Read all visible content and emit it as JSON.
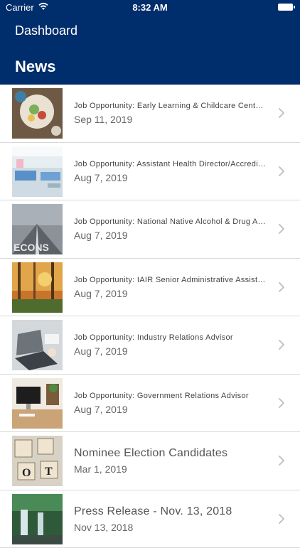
{
  "status_bar": {
    "carrier": "Carrier",
    "time": "8:32 AM"
  },
  "nav": {
    "back_label": "Dashboard",
    "title": "News"
  },
  "news": [
    {
      "title": "Job Opportunity: Early Learning & Childcare Centre Manager",
      "date": "Sep 11, 2019",
      "thumb": "food-photo",
      "large": false
    },
    {
      "title": "Job Opportunity: Assistant Health Director/Accreditation",
      "date": "Aug 7, 2019",
      "thumb": "hospital-room-photo",
      "large": false
    },
    {
      "title": "Job Opportunity: National Native Alcohol & Drug Abuse Program",
      "date": "Aug 7, 2019",
      "thumb": "road-photo",
      "large": false
    },
    {
      "title": "Job Opportunity: IAIR Senior Administrative Assistant",
      "date": "Aug 7, 2019",
      "thumb": "autumn-forest-photo",
      "large": false
    },
    {
      "title": "Job Opportunity: Industry Relations Advisor",
      "date": "Aug 7, 2019",
      "thumb": "laptop-desk-photo",
      "large": false
    },
    {
      "title": "Job Opportunity: Government Relations Advisor",
      "date": "Aug 7, 2019",
      "thumb": "office-desk-photo",
      "large": false
    },
    {
      "title": "Nominee Election Candidates",
      "date": "Mar 1, 2019",
      "thumb": "letter-tiles-photo",
      "large": true
    },
    {
      "title": "Press Release - Nov. 13, 2018",
      "date": "Nov 13, 2018",
      "thumb": "waterfall-photo",
      "large": true
    }
  ],
  "colors": {
    "header": "#002d6b",
    "accent": "#ffffff",
    "separator": "#d9d9d9"
  }
}
